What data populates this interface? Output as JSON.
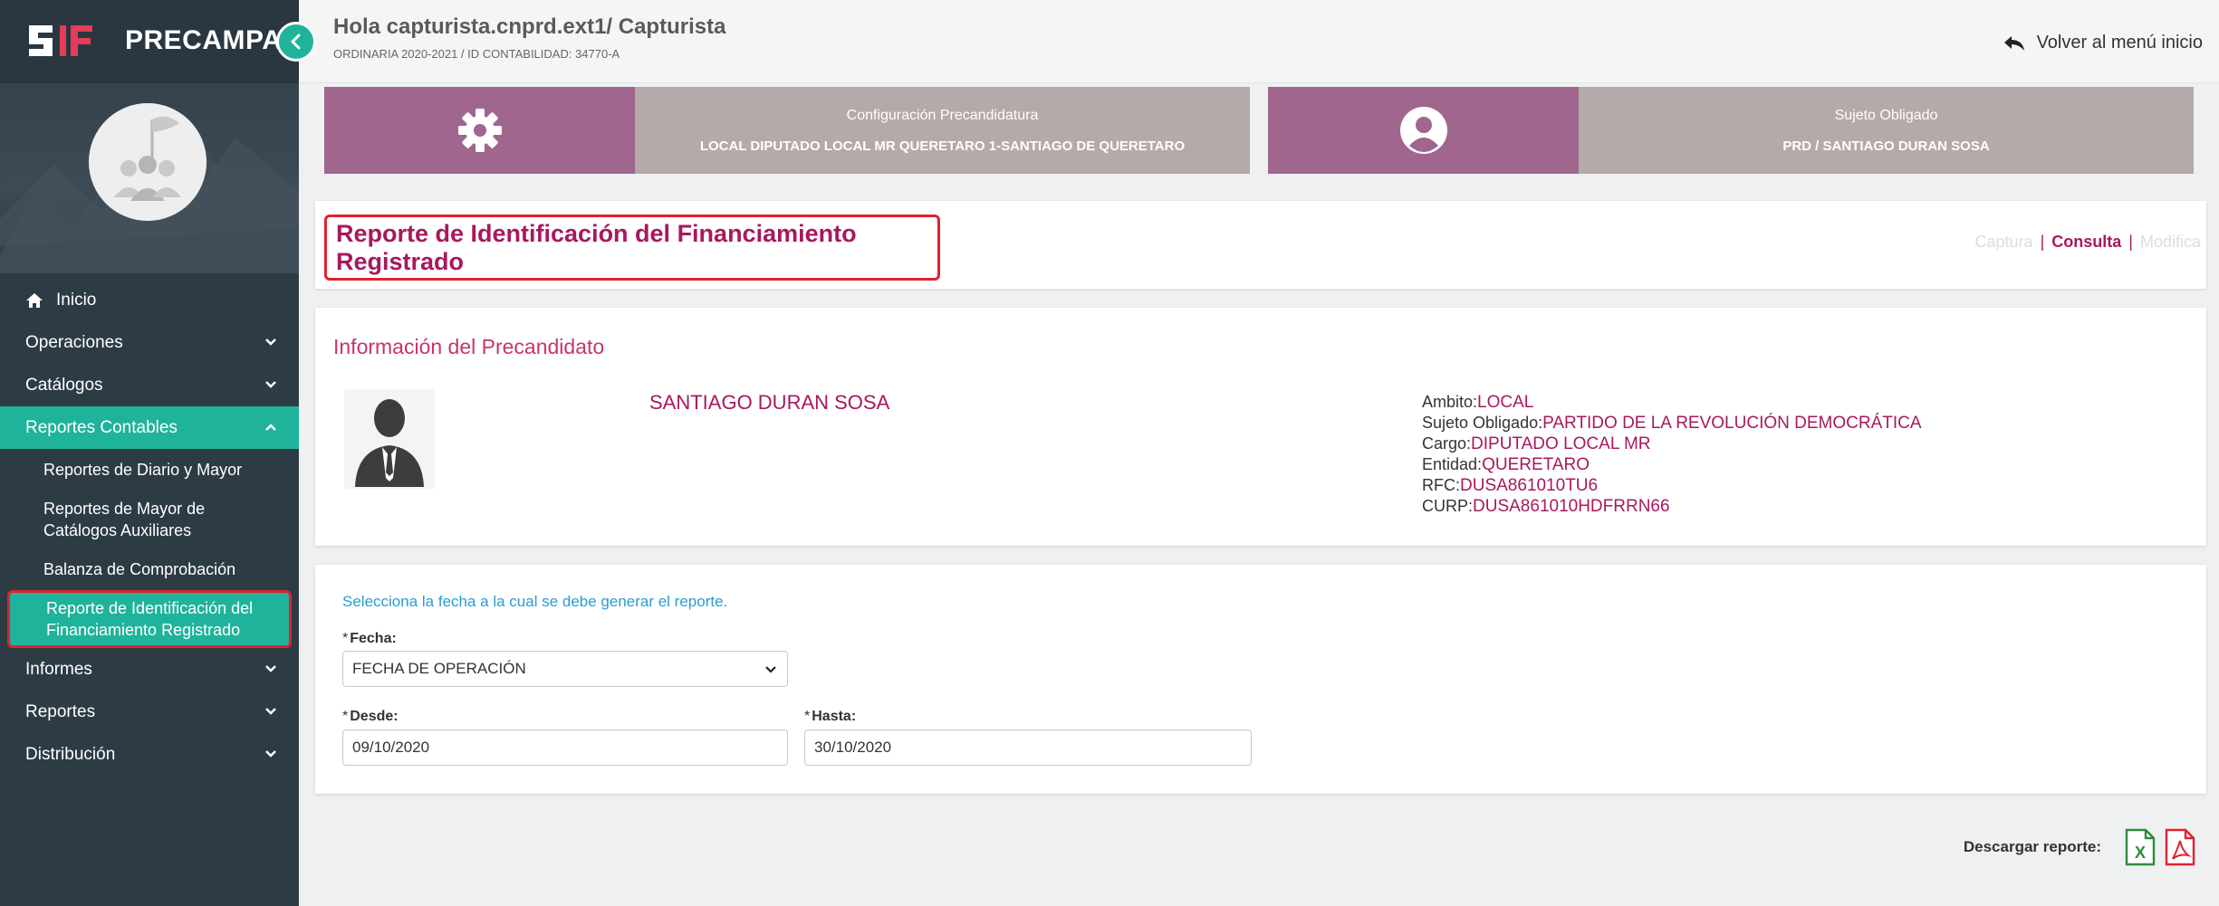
{
  "brand": {
    "logo_text": "IF",
    "title": "PRECAMPAÑA"
  },
  "header": {
    "greeting": "Hola capturista.cnprd.ext1/ Capturista",
    "subline": "ORDINARIA 2020-2021 / ID CONTABILIDAD: 34770-A",
    "back_label": "Volver al menú inicio"
  },
  "cards": [
    {
      "icon": "gear-icon",
      "title": "Configuración Precandidatura",
      "value": "LOCAL DIPUTADO LOCAL MR QUERETARO 1-SANTIAGO DE QUERETARO"
    },
    {
      "icon": "user-circle-icon",
      "title": "Sujeto Obligado",
      "value": "PRD / SANTIAGO DURAN SOSA"
    }
  ],
  "sidebar": {
    "home": "Inicio",
    "items": [
      {
        "label": "Operaciones"
      },
      {
        "label": "Catálogos"
      },
      {
        "label": "Reportes Contables"
      },
      {
        "label": "Informes"
      },
      {
        "label": "Reportes"
      },
      {
        "label": "Distribución"
      }
    ],
    "subitems": [
      {
        "label": "Reportes de Diario y Mayor"
      },
      {
        "label": "Reportes de Mayor de Catálogos Auxiliares"
      },
      {
        "label": "Balanza de Comprobación"
      },
      {
        "label": "Reporte de Identificación del Financiamiento Registrado"
      }
    ]
  },
  "page": {
    "title": "Reporte de Identificación del Financiamiento Registrado",
    "modes": {
      "captura": "Captura",
      "consulta": "Consulta",
      "modifica": "Modifica",
      "sep": "|"
    }
  },
  "candidate": {
    "section_title": "Información del Precandidato",
    "name": "SANTIAGO DURAN SOSA",
    "details": [
      {
        "label": "Ambito:",
        "value": "LOCAL"
      },
      {
        "label": "Sujeto Obligado:",
        "value": "PARTIDO DE LA REVOLUCIÓN DEMOCRÁTICA"
      },
      {
        "label": "Cargo:",
        "value": "DIPUTADO LOCAL MR"
      },
      {
        "label": "Entidad:",
        "value": "QUERETARO"
      },
      {
        "label": "RFC:",
        "value": "DUSA861010TU6"
      },
      {
        "label": "CURP:",
        "value": "DUSA861010HDFRRN66"
      }
    ]
  },
  "form": {
    "hint": "Selecciona la fecha a la cual se debe generar el reporte.",
    "required_mark": "*",
    "fecha_label": "Fecha:",
    "fecha_value": "FECHA DE OPERACIÓN",
    "desde_label": "Desde:",
    "desde_value": "09/10/2020",
    "hasta_label": "Hasta:",
    "hasta_value": "30/10/2020"
  },
  "download": {
    "label": "Descargar reporte:",
    "excel_letter": "X"
  },
  "colors": {
    "sidebar": "#2d3b45",
    "accent_teal": "#1fb39b",
    "magenta": "#a8185e",
    "card_purple": "#a0668e",
    "card_gray": "#b3aaa9",
    "highlight_red": "#e0222f"
  }
}
